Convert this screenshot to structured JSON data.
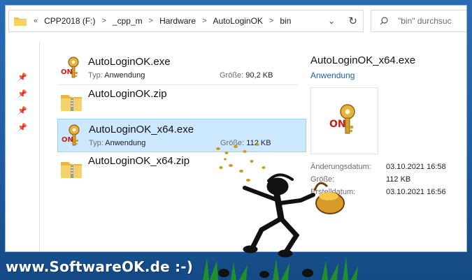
{
  "address_bar": {
    "lead": "«",
    "crumbs": [
      "CPP2018 (F:)",
      "_cpp_m",
      "Hardware",
      "AutoLoginOK",
      "bin"
    ],
    "separator": ">",
    "dropdown_icon": "chevron-down-icon",
    "refresh_icon": "refresh-icon"
  },
  "search": {
    "placeholder": "\"bin\" durchsuc"
  },
  "files": [
    {
      "name": "AutoLoginOK.exe",
      "type_label": "Typ:",
      "type": "Anwendung",
      "size_label": "Größe:",
      "size": "90,2 KB",
      "icon": "key-app-icon"
    },
    {
      "name": "AutoLoginOK.zip",
      "icon": "zip-folder-icon"
    },
    {
      "name": "AutoLoginOK_x64.exe",
      "type_label": "Typ:",
      "type": "Anwendung",
      "size_label": "Größe:",
      "size": "112 KB",
      "icon": "key-app-icon",
      "selected": true
    },
    {
      "name": "AutoLoginOK_x64.zip",
      "icon": "zip-folder-icon"
    }
  ],
  "preview": {
    "title": "AutoLoginOK_x64.exe",
    "type": "Anwendung",
    "rows": [
      {
        "label": "Änderungsdatum:",
        "value": "03.10.2021 16:58"
      },
      {
        "label": "Größe:",
        "value": "112 KB"
      },
      {
        "label": "Erstelldatum:",
        "value": "03.10.2021 16:56"
      }
    ]
  },
  "watermark": "www.SoftwareOK.de :-)",
  "colors": {
    "accent": "#1a5fb4",
    "selection": "#cce8ff",
    "frame": "#1d5c9f"
  }
}
